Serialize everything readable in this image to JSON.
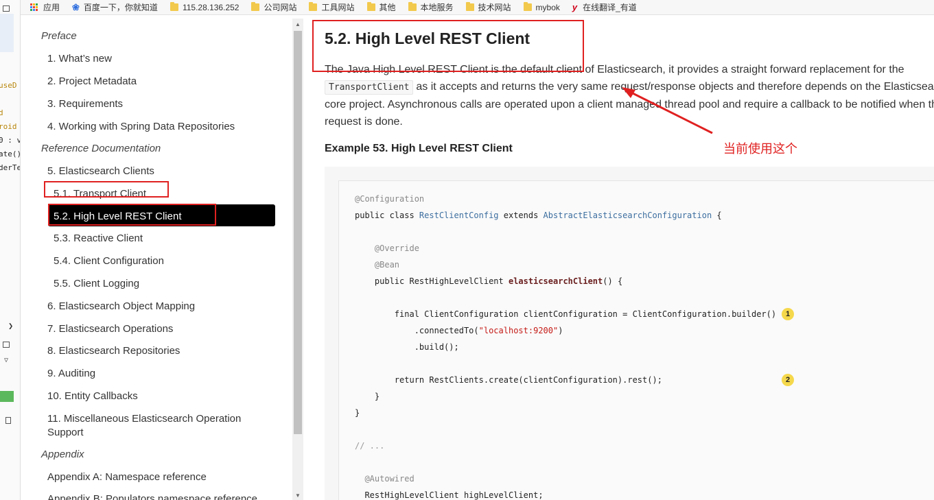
{
  "bookmarks": {
    "apps": "应用",
    "items": [
      {
        "label": "百度一下，你就知道",
        "icon": "baidu-icon"
      },
      {
        "label": "115.28.136.252",
        "icon": "folder-icon"
      },
      {
        "label": "公司网站",
        "icon": "folder-icon"
      },
      {
        "label": "工具网站",
        "icon": "folder-icon"
      },
      {
        "label": "其他",
        "icon": "folder-icon"
      },
      {
        "label": "本地服务",
        "icon": "folder-icon"
      },
      {
        "label": "技术网站",
        "icon": "folder-icon"
      },
      {
        "label": "mybok",
        "icon": "folder-icon"
      },
      {
        "label": "在线翻译_有道",
        "icon": "youdao-icon"
      }
    ]
  },
  "edge_fragments": [
    "useD",
    "d",
    "roid",
    "0 : v",
    "ate()",
    "derTe"
  ],
  "toc": {
    "items": [
      {
        "label": "Preface",
        "kind": "section"
      },
      {
        "label": "1. What’s new"
      },
      {
        "label": "2. Project Metadata"
      },
      {
        "label": "3. Requirements"
      },
      {
        "label": "4. Working with Spring Data Repositories"
      },
      {
        "label": "Reference Documentation",
        "kind": "section"
      },
      {
        "label": "5. Elasticsearch Clients"
      },
      {
        "label": "5.1. Transport Client"
      },
      {
        "label": "5.2. High Level REST Client",
        "active": true
      },
      {
        "label": "5.3. Reactive Client"
      },
      {
        "label": "5.4. Client Configuration"
      },
      {
        "label": "5.5. Client Logging"
      },
      {
        "label": "6. Elasticsearch Object Mapping"
      },
      {
        "label": "7. Elasticsearch Operations"
      },
      {
        "label": "8. Elasticsearch Repositories"
      },
      {
        "label": "9. Auditing"
      },
      {
        "label": "10. Entity Callbacks"
      },
      {
        "label": "11. Miscellaneous Elasticsearch Operation"
      },
      {
        "label": "Support"
      },
      {
        "label": "Appendix",
        "kind": "section"
      },
      {
        "label": "Appendix A: Namespace reference"
      },
      {
        "label": "Appendix B: Populators namespace reference"
      }
    ]
  },
  "main": {
    "title": "5.2. High Level REST Client",
    "para": {
      "line1": "The Java High Level REST Client is the default client of Elasticsearch, it provides a straight forward replacement for the",
      "code": "TransportClient",
      "line2_rest": "as it accepts and returns the very same request/response objects and therefore depends on the Elasticsearch",
      "line3": "core project. Asynchronous calls are operated upon a client managed thread pool and require a callback to be notified when the",
      "line4": "request is done."
    },
    "example_title": "Example 53. High Level REST Client",
    "code": {
      "l1": "@Configuration",
      "l2a": "public class ",
      "l2b": "RestClientConfig",
      "l2c": " extends ",
      "l2d": "AbstractElasticsearchConfiguration",
      "l2e": " {",
      "l3": "@Override",
      "l4": "@Bean",
      "l5a": "public RestHighLevelClient ",
      "l5b": "elasticsearchClient",
      "l5c": "() {",
      "l6": "final ClientConfiguration clientConfiguration = ClientConfiguration.builder()",
      "l7a": ".connectedTo(",
      "l7b": "\"localhost:9200\"",
      "l7c": ")",
      "l8": ".build();",
      "l9": "return RestClients.create(clientConfiguration).rest();",
      "l10": "}",
      "l11": "}",
      "l12": "// ...",
      "l13": "@Autowired",
      "l14": "RestHighLevelClient highLevelClient;",
      "callout1": "1",
      "callout2": "2"
    }
  },
  "annotation": {
    "note": "当前使用这个",
    "color": "#e02020"
  }
}
